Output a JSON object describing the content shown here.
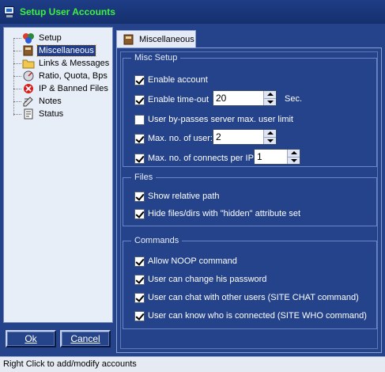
{
  "window": {
    "title": "Setup User Accounts"
  },
  "tree": {
    "items": [
      {
        "label": "Setup",
        "icon": "blocks-icon",
        "selected": false
      },
      {
        "label": "Miscellaneous",
        "icon": "book-icon",
        "selected": true
      },
      {
        "label": "Links & Messages",
        "icon": "folder-icon",
        "selected": false
      },
      {
        "label": "Ratio, Quota, Bps",
        "icon": "gauge-icon",
        "selected": false
      },
      {
        "label": "IP & Banned Files",
        "icon": "ban-icon",
        "selected": false
      },
      {
        "label": "Notes",
        "icon": "notes-icon",
        "selected": false
      },
      {
        "label": "Status",
        "icon": "document-icon",
        "selected": false
      }
    ]
  },
  "buttons": {
    "ok": "Ok",
    "cancel": "Cancel"
  },
  "tab": {
    "label": "Miscellaneous"
  },
  "misc_setup": {
    "title": "Misc Setup",
    "enable_account": {
      "label": "Enable account",
      "checked": true
    },
    "enable_timeout": {
      "label": "Enable time-out",
      "checked": true,
      "value": "20",
      "unit": "Sec."
    },
    "bypass_limit": {
      "label": "User by-passes server max. user limit",
      "checked": false
    },
    "max_users": {
      "label": "Max. no. of user:",
      "checked": true,
      "value": "2"
    },
    "max_connects": {
      "label": "Max. no. of connects per IP",
      "checked": true,
      "value": "1"
    }
  },
  "files": {
    "title": "Files",
    "show_relative": {
      "label": "Show relative path",
      "checked": true
    },
    "hide_hidden": {
      "label": "Hide files/dirs with \"hidden\" attribute set",
      "checked": true
    }
  },
  "commands": {
    "title": "Commands",
    "allow_noop": {
      "label": "Allow NOOP command",
      "checked": true
    },
    "change_password": {
      "label": "User can change his password",
      "checked": true
    },
    "chat": {
      "label": "User can chat with other users (SITE CHAT command)",
      "checked": true
    },
    "know_who": {
      "label": "User can know who is connected (SITE WHO command)",
      "checked": true
    }
  },
  "status": {
    "text": "Right Click to add/modify accounts"
  },
  "colors": {
    "accent": "#25438a",
    "title_text": "#3cf23c",
    "selection": "#1f3d8a"
  }
}
